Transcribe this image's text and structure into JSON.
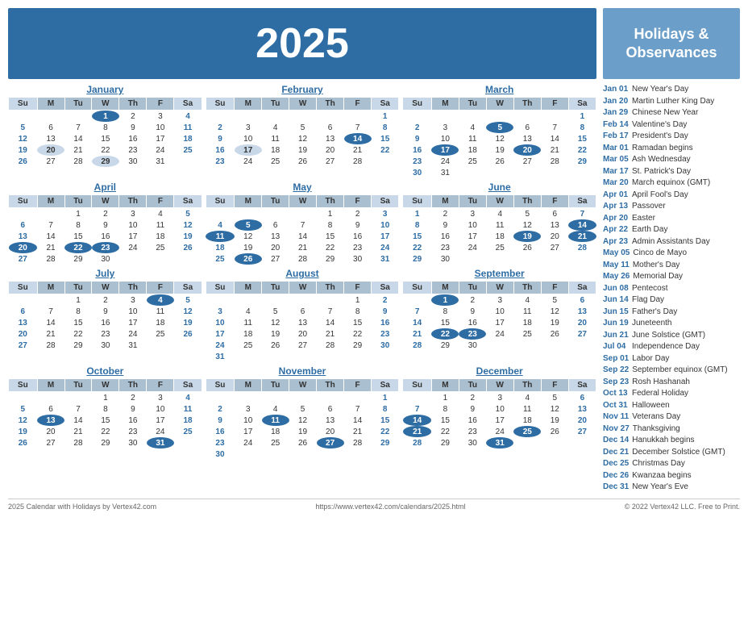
{
  "year": "2025",
  "header": {
    "title": "2025",
    "holidays_title": "Holidays & Observances"
  },
  "months": [
    {
      "name": "January",
      "offset": 3,
      "days": 31,
      "highlighted": [
        1,
        20
      ],
      "blue_circle": [
        1
      ],
      "rows": [
        [
          "",
          "",
          "",
          "1",
          "2",
          "3",
          "4"
        ],
        [
          "5",
          "6",
          "7",
          "8",
          "9",
          "10",
          "11"
        ],
        [
          "12",
          "13",
          "14",
          "15",
          "16",
          "17",
          "18"
        ],
        [
          "19",
          "20",
          "21",
          "22",
          "23",
          "24",
          "25"
        ],
        [
          "26",
          "27",
          "28",
          "29",
          "30",
          "31",
          ""
        ]
      ],
      "bold": [
        1,
        20,
        29
      ],
      "circle_blue": [
        1
      ],
      "highlight_gray": [
        20,
        29
      ]
    },
    {
      "name": "February",
      "offset": 6,
      "rows": [
        [
          "",
          "",
          "",
          "",
          "",
          "",
          "1"
        ],
        [
          "2",
          "3",
          "4",
          "5",
          "6",
          "7",
          "8"
        ],
        [
          "9",
          "10",
          "11",
          "12",
          "13",
          "14",
          "15"
        ],
        [
          "16",
          "17",
          "18",
          "19",
          "20",
          "21",
          "22"
        ],
        [
          "23",
          "24",
          "25",
          "26",
          "27",
          "28",
          ""
        ]
      ],
      "circle_blue": [
        14
      ],
      "highlight_gray": [
        17
      ]
    },
    {
      "name": "March",
      "offset": 6,
      "rows": [
        [
          "",
          "",
          "",
          "",
          "",
          "",
          "1"
        ],
        [
          "2",
          "3",
          "4",
          "5",
          "6",
          "7",
          "8"
        ],
        [
          "9",
          "10",
          "11",
          "12",
          "13",
          "14",
          "15"
        ],
        [
          "16",
          "17",
          "18",
          "19",
          "20",
          "21",
          "22"
        ],
        [
          "23",
          "24",
          "25",
          "26",
          "27",
          "28",
          "29"
        ],
        [
          "30",
          "31",
          "",
          "",
          "",
          "",
          ""
        ]
      ],
      "circle_blue": [
        5,
        17,
        20
      ]
    },
    {
      "name": "April",
      "offset": 2,
      "rows": [
        [
          "",
          "",
          "1",
          "2",
          "3",
          "4",
          "5"
        ],
        [
          "6",
          "7",
          "8",
          "9",
          "10",
          "11",
          "12"
        ],
        [
          "13",
          "14",
          "15",
          "16",
          "17",
          "18",
          "19"
        ],
        [
          "20",
          "21",
          "22",
          "23",
          "24",
          "25",
          "26"
        ],
        [
          "27",
          "28",
          "29",
          "30",
          "",
          "",
          ""
        ]
      ],
      "circle_blue": [
        20,
        22,
        23
      ]
    },
    {
      "name": "May",
      "offset": 4,
      "rows": [
        [
          "",
          "",
          "",
          "",
          "1",
          "2",
          "3"
        ],
        [
          "4",
          "5",
          "6",
          "7",
          "8",
          "9",
          "10"
        ],
        [
          "11",
          "12",
          "13",
          "14",
          "15",
          "16",
          "17"
        ],
        [
          "18",
          "19",
          "20",
          "21",
          "22",
          "23",
          "24"
        ],
        [
          "25",
          "26",
          "27",
          "28",
          "29",
          "30",
          "31"
        ]
      ],
      "circle_blue": [
        5,
        11,
        26
      ]
    },
    {
      "name": "June",
      "offset": 0,
      "rows": [
        [
          "1",
          "2",
          "3",
          "4",
          "5",
          "6",
          "7"
        ],
        [
          "8",
          "9",
          "10",
          "11",
          "12",
          "13",
          "14"
        ],
        [
          "15",
          "16",
          "17",
          "18",
          "19",
          "20",
          "21"
        ],
        [
          "22",
          "23",
          "24",
          "25",
          "26",
          "27",
          "28"
        ],
        [
          "29",
          "30",
          "",
          "",
          "",
          "",
          ""
        ]
      ],
      "circle_blue": [
        14,
        19,
        21
      ]
    },
    {
      "name": "July",
      "offset": 2,
      "rows": [
        [
          "",
          "",
          "1",
          "2",
          "3",
          "4",
          "5"
        ],
        [
          "6",
          "7",
          "8",
          "9",
          "10",
          "11",
          "12"
        ],
        [
          "13",
          "14",
          "15",
          "16",
          "17",
          "18",
          "19"
        ],
        [
          "20",
          "21",
          "22",
          "23",
          "24",
          "25",
          "26"
        ],
        [
          "27",
          "28",
          "29",
          "30",
          "31",
          "",
          ""
        ]
      ],
      "circle_blue": [
        4
      ]
    },
    {
      "name": "August",
      "offset": 5,
      "rows": [
        [
          "",
          "",
          "",
          "",
          "",
          "1",
          "2"
        ],
        [
          "3",
          "4",
          "5",
          "6",
          "7",
          "8",
          "9"
        ],
        [
          "10",
          "11",
          "12",
          "13",
          "14",
          "15",
          "16"
        ],
        [
          "17",
          "18",
          "19",
          "20",
          "21",
          "22",
          "23"
        ],
        [
          "24",
          "25",
          "26",
          "27",
          "28",
          "29",
          "30"
        ],
        [
          "31",
          "",
          "",
          "",
          "",
          "",
          ""
        ]
      ]
    },
    {
      "name": "September",
      "offset": 1,
      "rows": [
        [
          "",
          "1",
          "2",
          "3",
          "4",
          "5",
          "6"
        ],
        [
          "7",
          "8",
          "9",
          "10",
          "11",
          "12",
          "13"
        ],
        [
          "14",
          "15",
          "16",
          "17",
          "18",
          "19",
          "20"
        ],
        [
          "21",
          "22",
          "23",
          "24",
          "25",
          "26",
          "27"
        ],
        [
          "28",
          "29",
          "30",
          "",
          "",
          "",
          ""
        ]
      ],
      "circle_blue": [
        1,
        22,
        23
      ]
    },
    {
      "name": "October",
      "offset": 3,
      "rows": [
        [
          "",
          "",
          "",
          "1",
          "2",
          "3",
          "4"
        ],
        [
          "5",
          "6",
          "7",
          "8",
          "9",
          "10",
          "11"
        ],
        [
          "12",
          "13",
          "14",
          "15",
          "16",
          "17",
          "18"
        ],
        [
          "19",
          "20",
          "21",
          "22",
          "23",
          "24",
          "25"
        ],
        [
          "26",
          "27",
          "28",
          "29",
          "30",
          "31",
          ""
        ]
      ],
      "circle_blue": [
        13,
        31
      ]
    },
    {
      "name": "November",
      "offset": 6,
      "rows": [
        [
          "",
          "",
          "",
          "",
          "",
          "",
          "1"
        ],
        [
          "2",
          "3",
          "4",
          "5",
          "6",
          "7",
          "8"
        ],
        [
          "9",
          "10",
          "11",
          "12",
          "13",
          "14",
          "15"
        ],
        [
          "16",
          "17",
          "18",
          "19",
          "20",
          "21",
          "22"
        ],
        [
          "23",
          "24",
          "25",
          "26",
          "27",
          "28",
          "29"
        ],
        [
          "30",
          "",
          "",
          "",
          "",
          "",
          ""
        ]
      ],
      "circle_blue": [
        11,
        27
      ]
    },
    {
      "name": "December",
      "offset": 1,
      "rows": [
        [
          "",
          "1",
          "2",
          "3",
          "4",
          "5",
          "6"
        ],
        [
          "7",
          "8",
          "9",
          "10",
          "11",
          "12",
          "13"
        ],
        [
          "14",
          "15",
          "16",
          "17",
          "18",
          "19",
          "20"
        ],
        [
          "21",
          "22",
          "23",
          "24",
          "25",
          "26",
          "27"
        ],
        [
          "28",
          "29",
          "30",
          "31",
          "",
          "",
          ""
        ]
      ],
      "circle_blue": [
        14,
        21,
        25,
        31
      ]
    }
  ],
  "holidays": [
    {
      "date": "Jan 01",
      "name": "New Year's Day"
    },
    {
      "date": "Jan 20",
      "name": "Martin Luther King Day"
    },
    {
      "date": "Jan 29",
      "name": "Chinese New Year"
    },
    {
      "date": "Feb 14",
      "name": "Valentine's Day"
    },
    {
      "date": "Feb 17",
      "name": "President's Day"
    },
    {
      "date": "Mar 01",
      "name": "Ramadan begins"
    },
    {
      "date": "Mar 05",
      "name": "Ash Wednesday"
    },
    {
      "date": "Mar 17",
      "name": "St. Patrick's Day"
    },
    {
      "date": "Mar 20",
      "name": "March equinox (GMT)"
    },
    {
      "date": "Apr 01",
      "name": "April Fool's Day"
    },
    {
      "date": "Apr 13",
      "name": "Passover"
    },
    {
      "date": "Apr 20",
      "name": "Easter"
    },
    {
      "date": "Apr 22",
      "name": "Earth Day"
    },
    {
      "date": "Apr 23",
      "name": "Admin Assistants Day"
    },
    {
      "date": "May 05",
      "name": "Cinco de Mayo"
    },
    {
      "date": "May 11",
      "name": "Mother's Day"
    },
    {
      "date": "May 26",
      "name": "Memorial Day"
    },
    {
      "date": "Jun 08",
      "name": "Pentecost"
    },
    {
      "date": "Jun 14",
      "name": "Flag Day"
    },
    {
      "date": "Jun 15",
      "name": "Father's Day"
    },
    {
      "date": "Jun 19",
      "name": "Juneteenth"
    },
    {
      "date": "Jun 21",
      "name": "June Solstice (GMT)"
    },
    {
      "date": "Jul 04",
      "name": "Independence Day"
    },
    {
      "date": "Sep 01",
      "name": "Labor Day"
    },
    {
      "date": "Sep 22",
      "name": "September equinox (GMT)"
    },
    {
      "date": "Sep 23",
      "name": "Rosh Hashanah"
    },
    {
      "date": "Oct 13",
      "name": "Federal Holiday"
    },
    {
      "date": "Oct 31",
      "name": "Halloween"
    },
    {
      "date": "Nov 11",
      "name": "Veterans Day"
    },
    {
      "date": "Nov 27",
      "name": "Thanksgiving"
    },
    {
      "date": "Dec 14",
      "name": "Hanukkah begins"
    },
    {
      "date": "Dec 21",
      "name": "December Solstice (GMT)"
    },
    {
      "date": "Dec 25",
      "name": "Christmas Day"
    },
    {
      "date": "Dec 26",
      "name": "Kwanzaa begins"
    },
    {
      "date": "Dec 31",
      "name": "New Year's Eve"
    }
  ],
  "footer": {
    "left": "2025 Calendar with Holidays by Vertex42.com",
    "center": "https://www.vertex42.com/calendars/2025.html",
    "right": "© 2022 Vertex42 LLC. Free to Print."
  }
}
